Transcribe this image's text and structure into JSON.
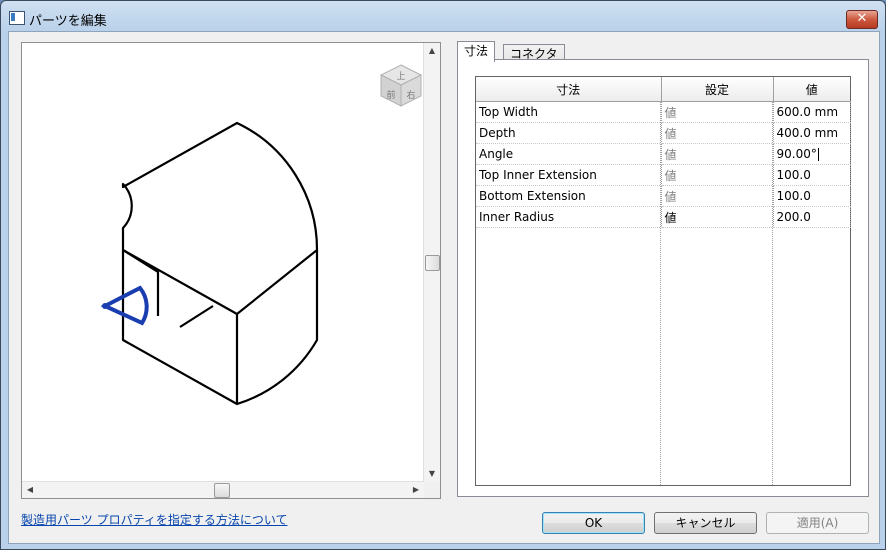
{
  "window": {
    "title": "パーツを編集",
    "close_label": "✕"
  },
  "tabs": [
    {
      "label": "寸法"
    },
    {
      "label": "コネクタ"
    }
  ],
  "grid": {
    "headers": [
      "寸法",
      "設定",
      "値"
    ],
    "rows": [
      {
        "name": "Top Width",
        "setting": "値",
        "value": "600.0 mm"
      },
      {
        "name": "Depth",
        "setting": "値",
        "value": "400.0 mm"
      },
      {
        "name": "Angle",
        "setting": "値",
        "value": "90.00°"
      },
      {
        "name": "Top Inner Extension",
        "setting": "値",
        "value": "100.0"
      },
      {
        "name": "Bottom Extension",
        "setting": "値",
        "value": "100.0"
      },
      {
        "name": "Inner Radius",
        "setting": "値",
        "value": "200.0"
      }
    ]
  },
  "viewcube": {
    "top": "上",
    "front": "前",
    "right": "右"
  },
  "help_link": "製造用パーツ プロパティを指定する方法について",
  "buttons": {
    "ok": "OK",
    "cancel": "キャンセル",
    "apply": "適用(A)"
  },
  "scroll_arrows": {
    "up": "▲",
    "down": "▼",
    "left": "◀",
    "right": "▶"
  },
  "colors": {
    "connector": "#1a3db0",
    "link": "#0645ad"
  },
  "icons": {
    "app": "window-icon",
    "close": "close-icon"
  }
}
